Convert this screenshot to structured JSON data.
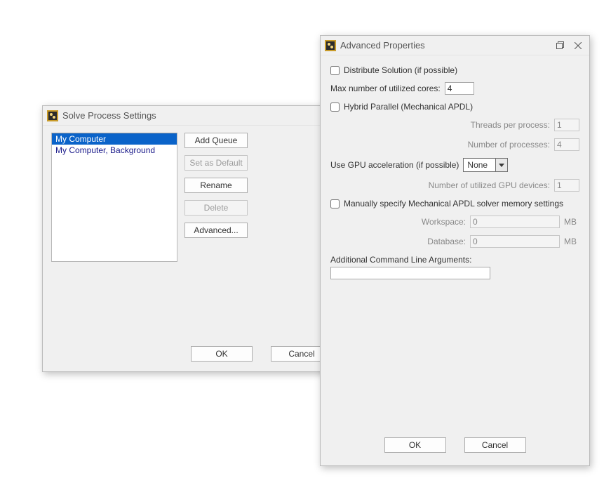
{
  "solve_window": {
    "title": "Solve Process Settings",
    "queues": [
      {
        "label": "My Computer",
        "selected": true
      },
      {
        "label": "My Computer, Background",
        "selected": false
      }
    ],
    "buttons": {
      "add_queue": "Add Queue",
      "set_default": "Set as Default",
      "rename": "Rename",
      "delete": "Delete",
      "advanced": "Advanced..."
    },
    "ok": "OK",
    "cancel": "Cancel"
  },
  "adv_window": {
    "title": "Advanced Properties",
    "distribute_label": "Distribute Solution (if possible)",
    "distribute_checked": false,
    "max_cores_label": "Max number of utilized cores:",
    "max_cores_value": "4",
    "hybrid_label": "Hybrid Parallel (Mechanical APDL)",
    "hybrid_checked": false,
    "threads_label": "Threads per process:",
    "threads_value": "1",
    "num_processes_label": "Number of processes:",
    "num_processes_value": "4",
    "gpu_label": "Use GPU acceleration (if possible)",
    "gpu_value": "None",
    "gpu_devices_label": "Number of utilized GPU devices:",
    "gpu_devices_value": "1",
    "mem_label": "Manually specify Mechanical APDL solver memory settings",
    "mem_checked": false,
    "workspace_label": "Workspace:",
    "workspace_value": "0",
    "workspace_unit": "MB",
    "database_label": "Database:",
    "database_value": "0",
    "database_unit": "MB",
    "cli_label": "Additional Command Line Arguments:",
    "cli_value": "",
    "ok": "OK",
    "cancel": "Cancel"
  }
}
